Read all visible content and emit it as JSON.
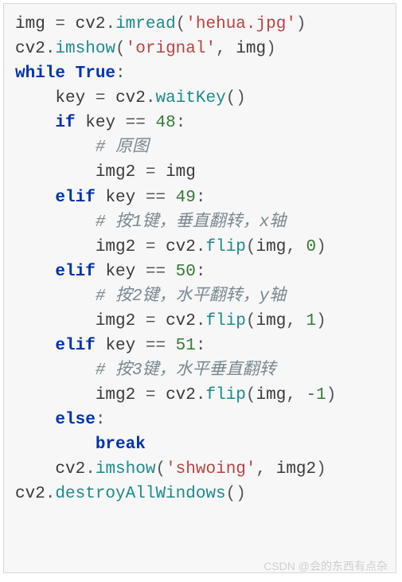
{
  "lines": [
    [
      {
        "cls": "tok-name",
        "t": "img "
      },
      {
        "cls": "tok-op",
        "t": "= "
      },
      {
        "cls": "tok-name",
        "t": "cv2"
      },
      {
        "cls": "tok-op",
        "t": "."
      },
      {
        "cls": "tok-func",
        "t": "imread"
      },
      {
        "cls": "tok-op",
        "t": "("
      },
      {
        "cls": "tok-str",
        "t": "'hehua.jpg'"
      },
      {
        "cls": "tok-op",
        "t": ")"
      }
    ],
    [
      {
        "cls": "tok-name",
        "t": "cv2"
      },
      {
        "cls": "tok-op",
        "t": "."
      },
      {
        "cls": "tok-func",
        "t": "imshow"
      },
      {
        "cls": "tok-op",
        "t": "("
      },
      {
        "cls": "tok-str",
        "t": "'orignal'"
      },
      {
        "cls": "tok-op",
        "t": ", "
      },
      {
        "cls": "tok-name",
        "t": "img"
      },
      {
        "cls": "tok-op",
        "t": ")"
      }
    ],
    [
      {
        "cls": "tok-kw",
        "t": "while"
      },
      {
        "cls": "tok-op",
        "t": " "
      },
      {
        "cls": "tok-bool",
        "t": "True"
      },
      {
        "cls": "tok-op",
        "t": ":"
      }
    ],
    [
      {
        "cls": "tok-op",
        "t": "    "
      },
      {
        "cls": "tok-name",
        "t": "key "
      },
      {
        "cls": "tok-op",
        "t": "= "
      },
      {
        "cls": "tok-name",
        "t": "cv2"
      },
      {
        "cls": "tok-op",
        "t": "."
      },
      {
        "cls": "tok-func",
        "t": "waitKey"
      },
      {
        "cls": "tok-op",
        "t": "()"
      }
    ],
    [
      {
        "cls": "tok-op",
        "t": "    "
      },
      {
        "cls": "tok-kw",
        "t": "if"
      },
      {
        "cls": "tok-name",
        "t": " key "
      },
      {
        "cls": "tok-op",
        "t": "== "
      },
      {
        "cls": "tok-num",
        "t": "48"
      },
      {
        "cls": "tok-op",
        "t": ":"
      }
    ],
    [
      {
        "cls": "tok-op",
        "t": "        "
      },
      {
        "cls": "tok-cmt",
        "t": "# 原图"
      }
    ],
    [
      {
        "cls": "tok-op",
        "t": "        "
      },
      {
        "cls": "tok-name",
        "t": "img2 "
      },
      {
        "cls": "tok-op",
        "t": "= "
      },
      {
        "cls": "tok-name",
        "t": "img"
      }
    ],
    [
      {
        "cls": "tok-op",
        "t": "    "
      },
      {
        "cls": "tok-kw",
        "t": "elif"
      },
      {
        "cls": "tok-name",
        "t": " key "
      },
      {
        "cls": "tok-op",
        "t": "== "
      },
      {
        "cls": "tok-num",
        "t": "49"
      },
      {
        "cls": "tok-op",
        "t": ":"
      }
    ],
    [
      {
        "cls": "tok-op",
        "t": "        "
      },
      {
        "cls": "tok-cmt",
        "t": "# 按1键，垂直翻转，x轴"
      }
    ],
    [
      {
        "cls": "tok-op",
        "t": "        "
      },
      {
        "cls": "tok-name",
        "t": "img2 "
      },
      {
        "cls": "tok-op",
        "t": "= "
      },
      {
        "cls": "tok-name",
        "t": "cv2"
      },
      {
        "cls": "tok-op",
        "t": "."
      },
      {
        "cls": "tok-func",
        "t": "flip"
      },
      {
        "cls": "tok-op",
        "t": "("
      },
      {
        "cls": "tok-name",
        "t": "img"
      },
      {
        "cls": "tok-op",
        "t": ", "
      },
      {
        "cls": "tok-num",
        "t": "0"
      },
      {
        "cls": "tok-op",
        "t": ")"
      }
    ],
    [
      {
        "cls": "tok-op",
        "t": "    "
      },
      {
        "cls": "tok-kw",
        "t": "elif"
      },
      {
        "cls": "tok-name",
        "t": " key "
      },
      {
        "cls": "tok-op",
        "t": "== "
      },
      {
        "cls": "tok-num",
        "t": "50"
      },
      {
        "cls": "tok-op",
        "t": ":"
      }
    ],
    [
      {
        "cls": "tok-op",
        "t": "        "
      },
      {
        "cls": "tok-cmt",
        "t": "# 按2键，水平翻转，y轴"
      }
    ],
    [
      {
        "cls": "tok-op",
        "t": "        "
      },
      {
        "cls": "tok-name",
        "t": "img2 "
      },
      {
        "cls": "tok-op",
        "t": "= "
      },
      {
        "cls": "tok-name",
        "t": "cv2"
      },
      {
        "cls": "tok-op",
        "t": "."
      },
      {
        "cls": "tok-func",
        "t": "flip"
      },
      {
        "cls": "tok-op",
        "t": "("
      },
      {
        "cls": "tok-name",
        "t": "img"
      },
      {
        "cls": "tok-op",
        "t": ", "
      },
      {
        "cls": "tok-num",
        "t": "1"
      },
      {
        "cls": "tok-op",
        "t": ")"
      }
    ],
    [
      {
        "cls": "tok-op",
        "t": "    "
      },
      {
        "cls": "tok-kw",
        "t": "elif"
      },
      {
        "cls": "tok-name",
        "t": " key "
      },
      {
        "cls": "tok-op",
        "t": "== "
      },
      {
        "cls": "tok-num",
        "t": "51"
      },
      {
        "cls": "tok-op",
        "t": ":"
      }
    ],
    [
      {
        "cls": "tok-op",
        "t": "        "
      },
      {
        "cls": "tok-cmt",
        "t": "# 按3键，水平垂直翻转"
      }
    ],
    [
      {
        "cls": "tok-op",
        "t": "        "
      },
      {
        "cls": "tok-name",
        "t": "img2 "
      },
      {
        "cls": "tok-op",
        "t": "= "
      },
      {
        "cls": "tok-name",
        "t": "cv2"
      },
      {
        "cls": "tok-op",
        "t": "."
      },
      {
        "cls": "tok-func",
        "t": "flip"
      },
      {
        "cls": "tok-op",
        "t": "("
      },
      {
        "cls": "tok-name",
        "t": "img"
      },
      {
        "cls": "tok-op",
        "t": ", "
      },
      {
        "cls": "tok-op",
        "t": "-"
      },
      {
        "cls": "tok-num",
        "t": "1"
      },
      {
        "cls": "tok-op",
        "t": ")"
      }
    ],
    [
      {
        "cls": "tok-op",
        "t": "    "
      },
      {
        "cls": "tok-kw",
        "t": "else"
      },
      {
        "cls": "tok-op",
        "t": ":"
      }
    ],
    [
      {
        "cls": "tok-op",
        "t": "        "
      },
      {
        "cls": "tok-kw",
        "t": "break"
      }
    ],
    [
      {
        "cls": "tok-op",
        "t": "    "
      },
      {
        "cls": "tok-name",
        "t": "cv2"
      },
      {
        "cls": "tok-op",
        "t": "."
      },
      {
        "cls": "tok-func",
        "t": "imshow"
      },
      {
        "cls": "tok-op",
        "t": "("
      },
      {
        "cls": "tok-str",
        "t": "'shwoing'"
      },
      {
        "cls": "tok-op",
        "t": ", "
      },
      {
        "cls": "tok-name",
        "t": "img2"
      },
      {
        "cls": "tok-op",
        "t": ")"
      }
    ],
    [
      {
        "cls": "tok-name",
        "t": "cv2"
      },
      {
        "cls": "tok-op",
        "t": "."
      },
      {
        "cls": "tok-func",
        "t": "destroyAllWindows"
      },
      {
        "cls": "tok-op",
        "t": "()"
      }
    ]
  ],
  "watermark": "CSDN @会的东西有点杂"
}
